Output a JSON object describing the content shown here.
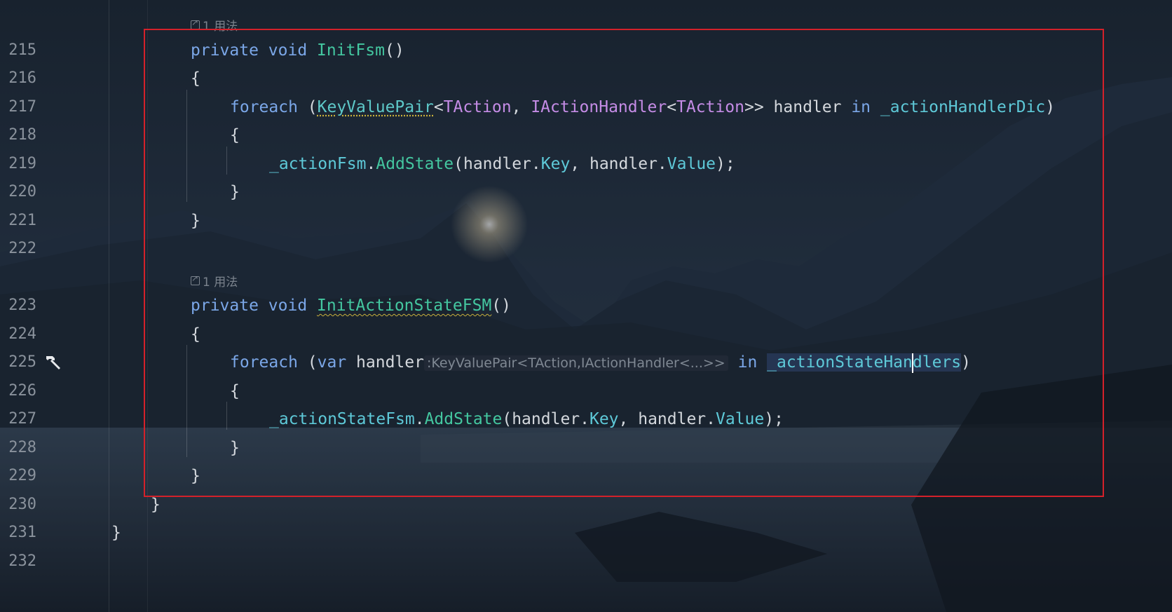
{
  "editor": {
    "usage_hint_1": "1 用法",
    "usage_hint_2": "1 用法",
    "line_numbers": [
      "215",
      "216",
      "217",
      "218",
      "219",
      "220",
      "221",
      "222",
      "223",
      "224",
      "225",
      "226",
      "227",
      "228",
      "229",
      "230",
      "231",
      "232"
    ],
    "gutter_icon": "hammer-icon",
    "code": {
      "l215": {
        "kw1": "private",
        "kw2": "void",
        "fn": "InitFsm",
        "tail": "()"
      },
      "l216": "{",
      "l217": {
        "kw": "foreach",
        "p1": " (",
        "t1": "KeyValuePair",
        "lt": "<",
        "t2": "TAction",
        "c": ", ",
        "t3": "IActionHandler",
        "lt2": "<",
        "t4": "TAction",
        "gt": ">>",
        "var": " handler ",
        "in": "in",
        "sp": " ",
        "fld": "_actionHandlerDic",
        "end": ")"
      },
      "l218": "{",
      "l219": {
        "fld": "_actionFsm",
        "dot": ".",
        "fn": "AddState",
        "p": "(handler.",
        "prop1": "Key",
        "mid": ", handler.",
        "prop2": "Value",
        "end": ");"
      },
      "l220": "}",
      "l221": "}",
      "l223": {
        "kw1": "private",
        "kw2": "void",
        "fn": "InitActionStateFSM",
        "tail": "()"
      },
      "l224": "{",
      "l225": {
        "kw": "foreach",
        "p1": " (",
        "kw2": "var",
        "var": " handler",
        "hint": ":KeyValuePair<TAction,IActionHandler<...>>",
        "in": "in",
        "fld_a": "_actionStateHan",
        "fld_b": "dlers",
        "end": ")"
      },
      "l226": "{",
      "l227": {
        "fld": "_actionStateFsm",
        "dot": ".",
        "fn": "AddState",
        "p": "(handler.",
        "prop1": "Key",
        "mid": ", handler.",
        "prop2": "Value",
        "end": ");"
      },
      "l228": "}",
      "l229": "}",
      "l230": "}",
      "l231": "}"
    }
  },
  "colors": {
    "keyword": "#7ba7e8",
    "method": "#44c7a0",
    "type": "#c58ce6",
    "field": "#5ec9d8",
    "highlight_box": "#d4212a"
  }
}
